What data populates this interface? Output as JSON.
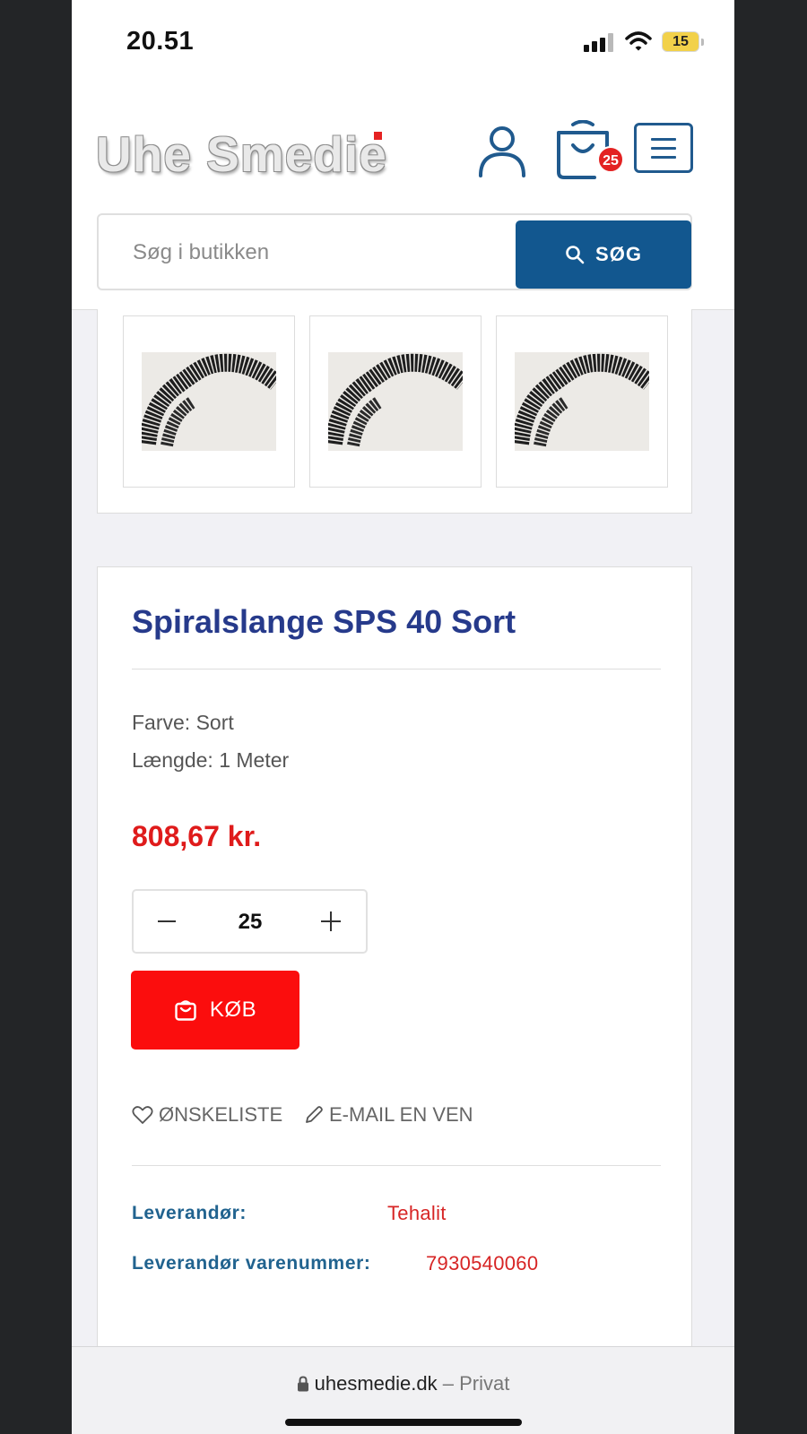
{
  "status_bar": {
    "time": "20.51",
    "battery": "15"
  },
  "header": {
    "logo": "Uhe Smedie",
    "cart_count": "25",
    "search": {
      "placeholder": "Søg i butikken",
      "button_label": "SØG"
    }
  },
  "gallery": {
    "thumbnails": [
      {
        "alt": "Spiralslange SPS 40 Sort"
      },
      {
        "alt": "Spiralslange SPS 40 Sort"
      },
      {
        "alt": "Spiralslange SPS 40 Sort"
      }
    ]
  },
  "product": {
    "title": "Spiralslange SPS 40 Sort",
    "attributes": [
      "Farve: Sort",
      "Længde: 1 Meter"
    ],
    "price": "808,67 kr.",
    "quantity": "25",
    "buy_label": "KØB",
    "wishlist_label": "ØNSKELISTE",
    "email_friend_label": "E-MAIL EN VEN",
    "supplier_label": "Leverandør:",
    "supplier_value": "Tehalit",
    "supplier_sku_label": "Leverandør varenummer:",
    "supplier_sku_value": "7930540060"
  },
  "browser": {
    "url": "uhesmedie.dk",
    "privacy": "– Privat"
  },
  "colors": {
    "title_blue": "#263a8b",
    "brand_blue": "#12578f",
    "price_red": "#df1b1b",
    "buy_red": "#fb0d0d"
  },
  "icons": [
    "signal-icon",
    "wifi-icon",
    "battery-icon",
    "user-icon",
    "shopping-bag-icon",
    "hamburger-menu-icon",
    "search-icon",
    "minus-icon",
    "plus-icon",
    "heart-icon",
    "pencil-icon",
    "lock-icon"
  ]
}
